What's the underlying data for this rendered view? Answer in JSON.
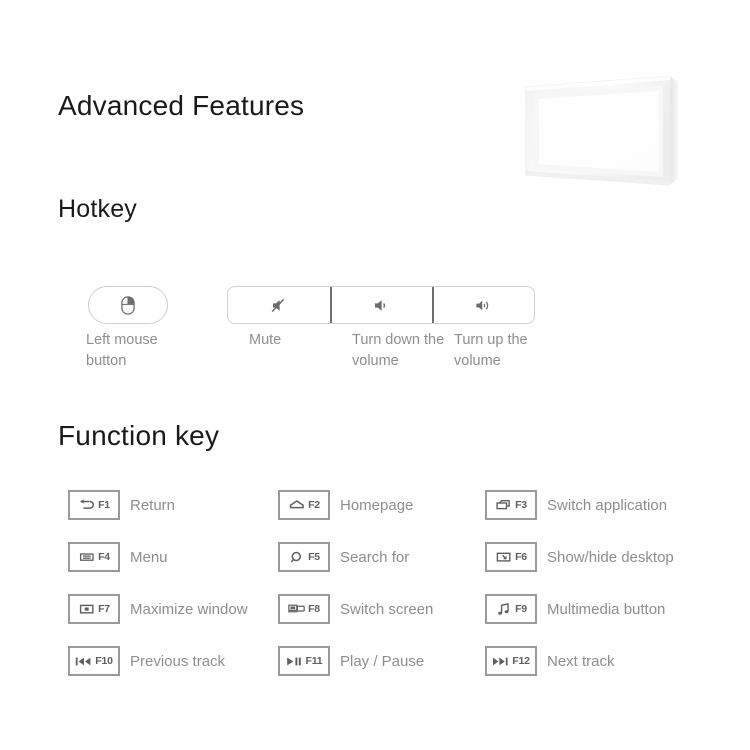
{
  "page": {
    "title": "Advanced Features",
    "background_color": "#ffffff",
    "heading_color": "#1a1a1a",
    "label_color": "#8e8e8e",
    "key_border_color": "#9a9a9a"
  },
  "sections": {
    "advanced_features_title": "Advanced Features",
    "hotkey_title": "Hotkey",
    "function_key_title": "Function key"
  },
  "product_photo": {
    "name": "wireless-keyboard-photo",
    "description": "white keyboard shown at an angle"
  },
  "hotkey": {
    "mouse": {
      "icon": "left-mouse-button-icon",
      "caption": "Left mouse button"
    },
    "volume_group": {
      "segments": [
        {
          "icon": "volume-mute-icon",
          "caption": "Mute"
        },
        {
          "icon": "volume-down-icon",
          "caption": "Turn down the volume"
        },
        {
          "icon": "volume-up-icon",
          "caption": "Turn up the volume"
        }
      ]
    }
  },
  "function_keys": {
    "rows": [
      [
        {
          "fn": "F1",
          "icon": "back-arrow-icon",
          "label": "Return"
        },
        {
          "fn": "F2",
          "icon": "home-icon",
          "label": "Homepage"
        },
        {
          "fn": "F3",
          "icon": "switch-app-icon",
          "label": "Switch application"
        }
      ],
      [
        {
          "fn": "F4",
          "icon": "menu-icon",
          "label": "Menu"
        },
        {
          "fn": "F5",
          "icon": "search-icon",
          "label": "Search for"
        },
        {
          "fn": "F6",
          "icon": "show-desktop-icon",
          "label": "Show/hide desktop"
        }
      ],
      [
        {
          "fn": "F7",
          "icon": "maximize-window-icon",
          "label": "Maximize window"
        },
        {
          "fn": "F8",
          "icon": "switch-screen-icon",
          "label": "Switch screen"
        },
        {
          "fn": "F9",
          "icon": "music-note-icon",
          "label": "Multimedia button"
        }
      ],
      [
        {
          "fn": "F10",
          "icon": "previous-track-icon",
          "label": "Previous track"
        },
        {
          "fn": "F11",
          "icon": "play-pause-icon",
          "label": "Play / Pause"
        },
        {
          "fn": "F12",
          "icon": "next-track-icon",
          "label": "Next track"
        }
      ]
    ]
  }
}
